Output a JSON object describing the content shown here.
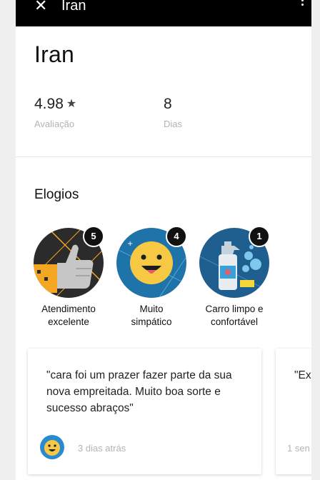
{
  "appbar": {
    "title": "Iran",
    "close_icon": "close-icon",
    "more_icon": "more-vertical-icon"
  },
  "profile": {
    "name": "Iran",
    "rating": "4.98",
    "rating_icon": "star-icon",
    "rating_label": "Avaliação",
    "days": "8",
    "days_label": "Dias"
  },
  "compliments": {
    "title": "Elogios",
    "items": [
      {
        "line1": "Atendimento",
        "line2": "excelente",
        "count": "5",
        "icon": "thumbs-up-icon"
      },
      {
        "line1": "Muito",
        "line2": "simpático",
        "count": "4",
        "icon": "smiley-face-icon"
      },
      {
        "line1": "Carro limpo e",
        "line2": "confortável",
        "count": "1",
        "icon": "spray-bottle-icon"
      }
    ]
  },
  "reviews": [
    {
      "text": "\"cara foi um prazer fazer parte da sua nova empreitada. Muito boa sorte e sucesso abraços\"",
      "time": "3 dias atrás"
    },
    {
      "text": "\"Ex",
      "time": "1 sen"
    }
  ],
  "colors": {
    "appbar_bg": "#000000",
    "badge_dark": "#2b2b2b",
    "badge_blue": "#1e73a8",
    "badge_orange": "#f5a623",
    "secondary_text": "#b3b3b3"
  }
}
